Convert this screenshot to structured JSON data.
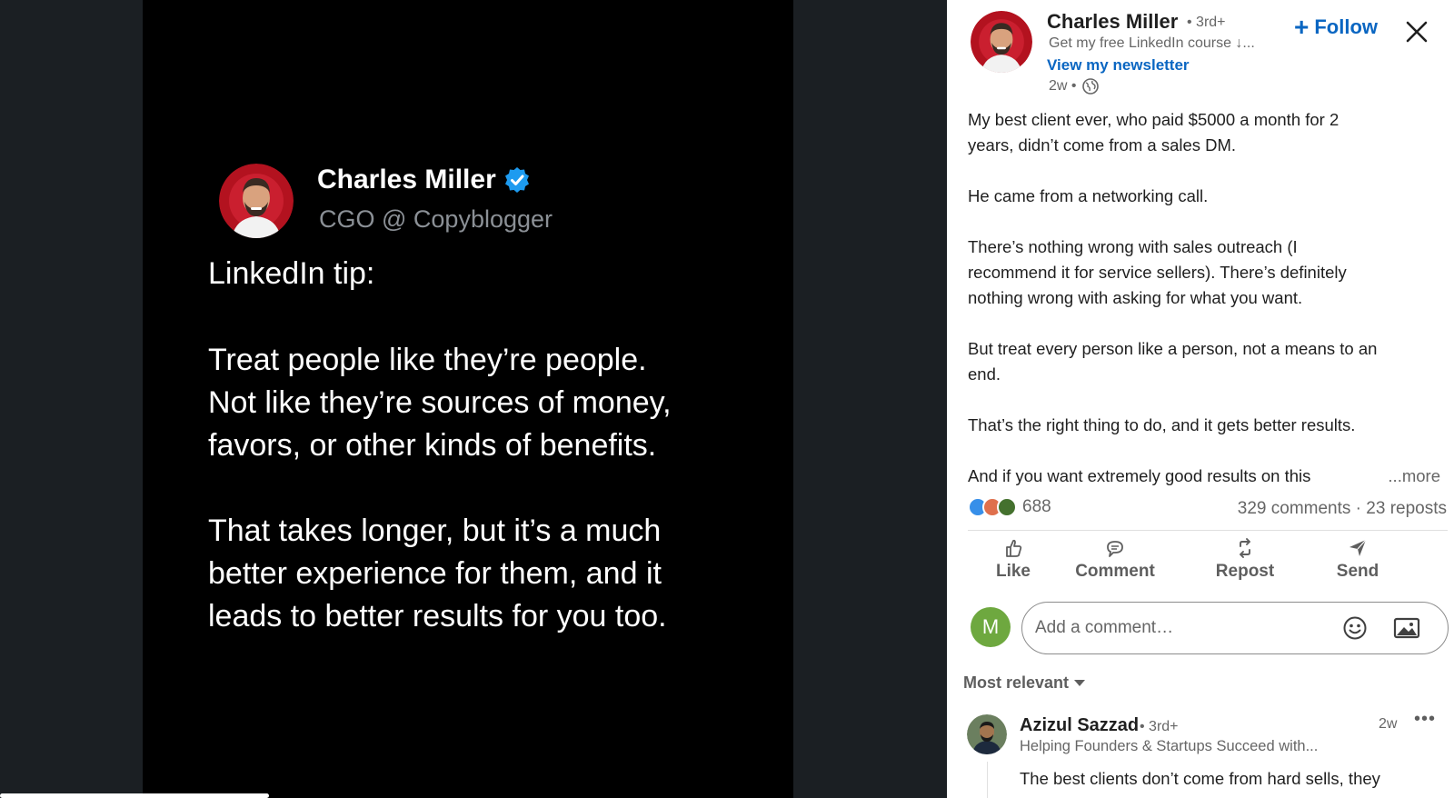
{
  "media": {
    "author_name": "Charles Miller",
    "author_role": "CGO @ Copyblogger",
    "tip_title": "LinkedIn tip:",
    "paragraph1": [
      "Treat people like they’re people.",
      "Not like they’re sources of money,",
      "favors, or other kinds of benefits."
    ],
    "paragraph2": [
      "That takes longer, but it’s a much",
      "better experience for them, and it",
      "leads to better results for you too."
    ]
  },
  "post": {
    "author_name": "Charles Miller",
    "degree": "• 3rd+",
    "headline": "Get my free LinkedIn course ↓...",
    "newsletter_link": "View my newsletter",
    "time": "2w •",
    "follow_label": "Follow",
    "body": [
      [
        "My best client ever, who paid $5000 a month for 2",
        "years, didn’t come from a sales DM."
      ],
      [
        "He came from a networking call."
      ],
      [
        "There’s nothing wrong with sales outreach (I",
        "recommend it for service sellers). There’s definitely",
        "nothing wrong with asking for what you want."
      ],
      [
        "But treat every person like a person, not a means to an",
        "end."
      ],
      [
        "That’s the right thing to do, and it gets better results."
      ],
      [
        "And if you want extremely good results on this"
      ]
    ],
    "more_label": "...more",
    "reaction_count": "688",
    "stats": "329 comments · 23 reposts",
    "actions": {
      "like": "Like",
      "comment": "Comment",
      "repost": "Repost",
      "send": "Send"
    }
  },
  "comment_box": {
    "avatar_initial": "M",
    "placeholder": "Add a comment…"
  },
  "sort_label": "Most relevant",
  "first_comment": {
    "name": "Azizul Sazzad",
    "degree": "• 3rd+",
    "headline": "Helping Founders & Startups Succeed with...",
    "time": "2w",
    "more": "•••",
    "text": "The best clients don’t come from hard sells, they"
  },
  "colors": {
    "link_blue": "#0a66c2",
    "verified_blue": "#1d9bf0",
    "avatar_red": "#c8102e",
    "comment_avatar_green": "#6ea83f"
  }
}
